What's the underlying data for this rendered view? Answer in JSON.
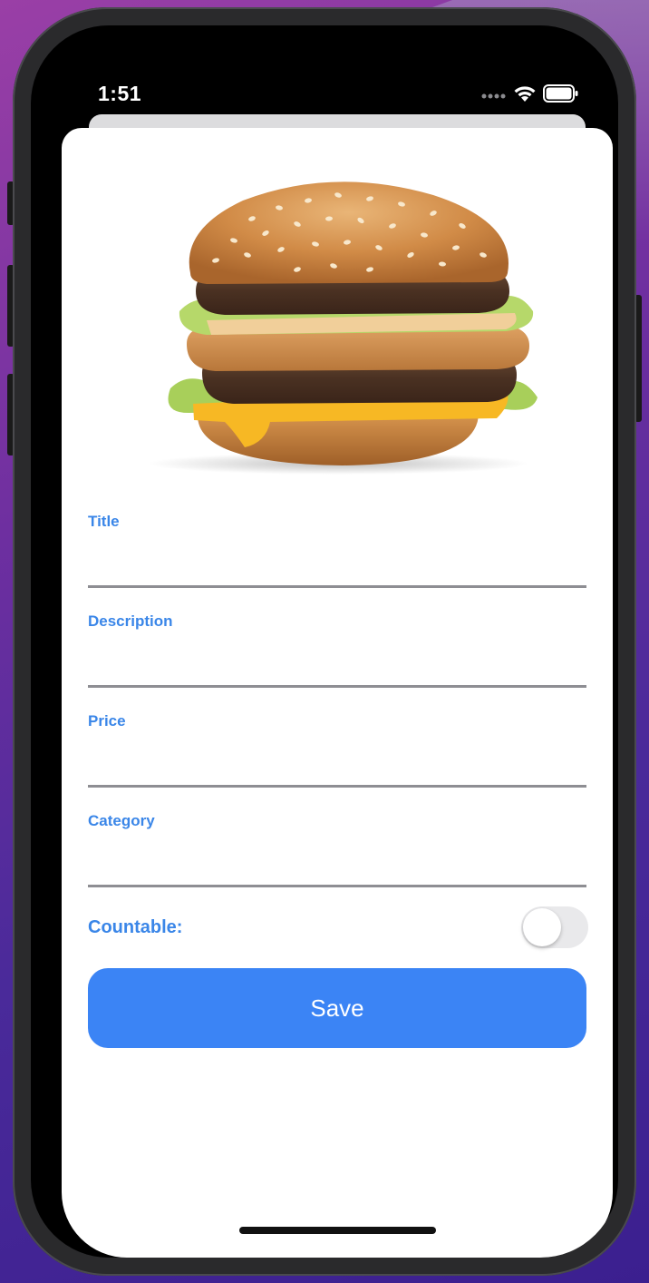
{
  "status_bar": {
    "time": "1:51"
  },
  "form": {
    "title_label": "Title",
    "title_value": "",
    "description_label": "Description",
    "description_value": "",
    "price_label": "Price",
    "price_value": "",
    "category_label": "Category",
    "category_value": "",
    "countable_label": "Countable:",
    "countable_enabled": false,
    "save_label": "Save"
  },
  "colors": {
    "accent_label": "#3a86e8",
    "save_button": "#3b84f5",
    "toggle_off": "#e9e9eb"
  },
  "icons": [
    "signal-icon",
    "wifi-icon",
    "battery-icon",
    "burger-image"
  ]
}
